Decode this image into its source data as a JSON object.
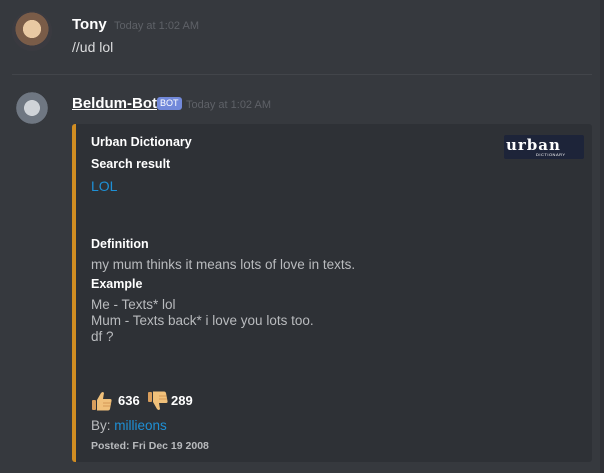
{
  "messages": [
    {
      "username": "Tony",
      "timestamp": "Today at 1:02 AM",
      "content": "//ud lol"
    },
    {
      "username": "Beldum-Bot",
      "badge": "BOT",
      "timestamp": "Today at 1:02 AM"
    }
  ],
  "embed": {
    "accent_color": "#d18d22",
    "author": "Urban Dictionary",
    "title": "Search result",
    "link_text": "LOL",
    "thumbnail_text": "urban",
    "thumbnail_subtext": "DICTIONARY",
    "fields": [
      {
        "name": "Definition",
        "value": "my mum thinks it means lots of love in texts."
      },
      {
        "name": "Example",
        "lines": [
          "Me - Texts* lol",
          "Mum - Texts back* i love you lots too.",
          "df ?"
        ]
      }
    ],
    "thumbs_up_count": "636",
    "thumbs_down_count": "289",
    "by_label": "By:",
    "by_user": "millieons",
    "footer": "Posted: Fri Dec 19 2008"
  }
}
